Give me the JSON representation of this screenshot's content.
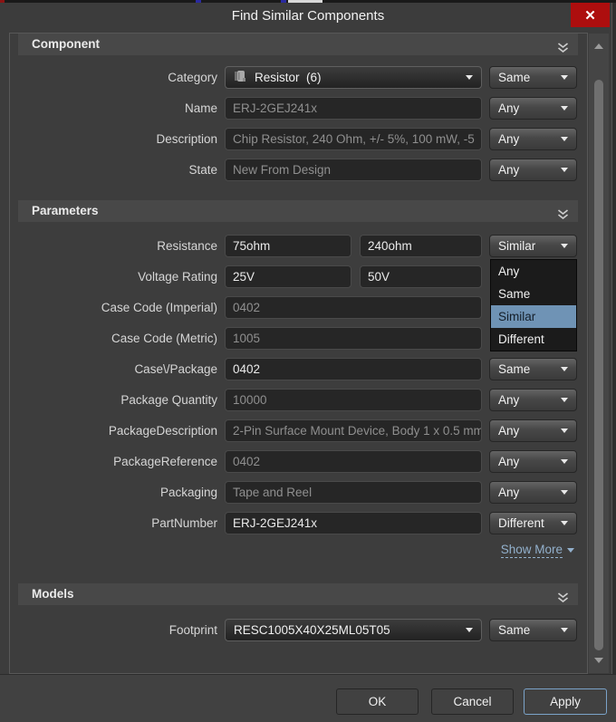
{
  "titlebar": {
    "title": "Find Similar Components",
    "close_icon": "✕"
  },
  "sections": {
    "component": {
      "title": "Component"
    },
    "parameters": {
      "title": "Parameters"
    },
    "models": {
      "title": "Models"
    }
  },
  "component_rows": [
    {
      "label": "Category",
      "value": "Resistor  (6)",
      "match": "Same"
    },
    {
      "label": "Name",
      "value": "ERJ-2GEJ241x",
      "match": "Any"
    },
    {
      "label": "Description",
      "value": "Chip Resistor, 240 Ohm, +/- 5%, 100 mW, -5",
      "match": "Any"
    },
    {
      "label": "State",
      "value": "New From Design",
      "match": "Any"
    }
  ],
  "parameter_rows": [
    {
      "label": "Resistance",
      "from": "75ohm",
      "to": "240ohm",
      "match": "Similar"
    },
    {
      "label": "Voltage Rating",
      "from": "25V",
      "to": "50V"
    },
    {
      "label": "Case Code (Imperial)",
      "value": "0402"
    },
    {
      "label": "Case Code (Metric)",
      "value": "1005"
    },
    {
      "label": "Case\\/Package",
      "value": "0402",
      "match": "Same"
    },
    {
      "label": "Package Quantity",
      "value": "10000",
      "match": "Any"
    },
    {
      "label": "PackageDescription",
      "value": "2-Pin Surface Mount Device, Body 1 x 0.5 mm",
      "match": "Any"
    },
    {
      "label": "PackageReference",
      "value": "0402",
      "match": "Any"
    },
    {
      "label": "Packaging",
      "value": "Tape and Reel",
      "match": "Any"
    },
    {
      "label": "PartNumber",
      "value": "ERJ-2GEJ241x",
      "match": "Different"
    }
  ],
  "match_popup": {
    "options": [
      "Any",
      "Same",
      "Similar",
      "Different"
    ],
    "selected": "Similar"
  },
  "show_more": {
    "label": "Show More"
  },
  "models_rows": [
    {
      "label": "Footprint",
      "value": "RESC1005X40X25ML05T05",
      "match": "Same"
    }
  ],
  "footer": {
    "ok_label": "OK",
    "cancel_label": "Cancel",
    "apply_label": "Apply"
  },
  "colors": {
    "selection_blue": "#6f93b5",
    "close_red": "#ad0e0e",
    "link_blue": "#93b1cd",
    "apply_border": "#7ba3c9"
  }
}
